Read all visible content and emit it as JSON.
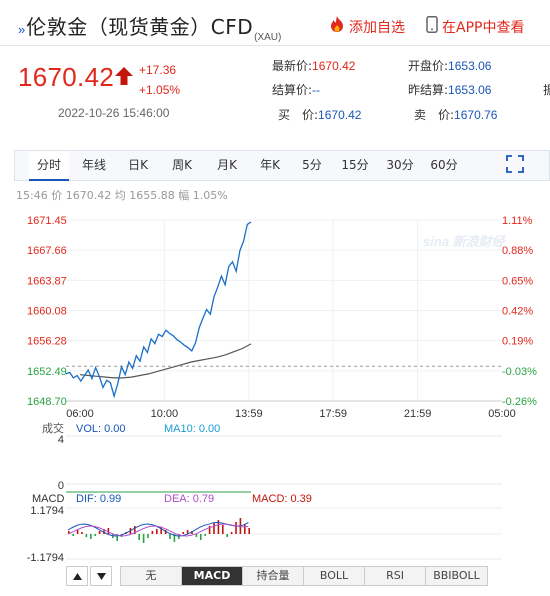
{
  "header": {
    "title_mark": "»",
    "title": "伦敦金（现货黄金）CFD",
    "code": "(XAU)",
    "watch_label": "添加自选",
    "app_label": "在APP中查看"
  },
  "quote": {
    "price": "1670.42",
    "change": "+17.36",
    "change_pct": "+1.05%",
    "time": "2022-10-26 15:46:00",
    "fields": [
      {
        "label": "最新价:",
        "value": "1670.42",
        "color": "red"
      },
      {
        "label": "开盘价:",
        "value": "1653.06",
        "color": "blue"
      },
      {
        "label": "结算价:",
        "value": "--",
        "color": "blue"
      },
      {
        "label": "昨结算:",
        "value": "1653.06",
        "color": "blue"
      },
      {
        "label": "买　价:",
        "value": "1670.42",
        "color": "blue"
      },
      {
        "label": "卖　价:",
        "value": "1670.76",
        "color": "blue"
      }
    ],
    "cutoff_glyph": "振"
  },
  "tabs": [
    "分时",
    "年线",
    "日K",
    "周K",
    "月K",
    "年K",
    "5分",
    "15分",
    "30分",
    "60分"
  ],
  "active_tab": "分时",
  "cursor_info": {
    "time": "15:46",
    "price_label": "价",
    "price": "1670.42",
    "avg_label": "均",
    "avg": "1655.88",
    "amp_label": "幅",
    "amp": "1.05%"
  },
  "watermark": "sina 新浪财经",
  "chart_data": {
    "type": "line",
    "y_ticks": [
      "1671.45",
      "1667.66",
      "1663.87",
      "1660.08",
      "1656.28",
      "1652.49",
      "1648.70"
    ],
    "pct_ticks": [
      "1.11%",
      "0.88%",
      "0.65%",
      "0.42%",
      "0.19%",
      "-0.03%",
      "-0.26%"
    ],
    "ylim": [
      1648.7,
      1671.45
    ],
    "prev_settle": 1653.06,
    "x_ticks": [
      "06:00",
      "10:00",
      "13:59",
      "17:59",
      "21:59",
      "05:00"
    ],
    "series": [
      {
        "name": "price",
        "color": "#1a6fc9"
      },
      {
        "name": "avg",
        "color": "#555555"
      }
    ],
    "price_y": [
      1652.1,
      1652.3,
      1651.6,
      1651.9,
      1651.2,
      1651.9,
      1652.6,
      1651.5,
      1652.9,
      1651.8,
      1650.4,
      1651.3,
      1651.0,
      1649.3,
      1650.9,
      1653.0,
      1652.0,
      1653.6,
      1652.8,
      1654.4,
      1653.7,
      1655.5,
      1654.8,
      1656.5,
      1655.9,
      1657.1,
      1656.8,
      1657.6,
      1657.2,
      1656.9,
      1656.4,
      1656.1,
      1655.7,
      1655.4,
      1655.0,
      1656.0,
      1657.9,
      1659.1,
      1660.2,
      1659.6,
      1661.8,
      1663.0,
      1664.4,
      1663.3,
      1665.6,
      1666.2,
      1665.0,
      1667.6,
      1668.8,
      1670.9,
      1671.2
    ],
    "avg_y": [
      1652.0,
      1651.9,
      1651.8,
      1651.7,
      1651.6,
      1651.6,
      1651.7,
      1651.9,
      1652.1,
      1652.4,
      1652.7,
      1653.0,
      1653.3,
      1653.6,
      1653.8,
      1654.0,
      1654.2,
      1654.5,
      1654.9,
      1655.3,
      1655.88
    ],
    "indicators": {
      "volume": {
        "label": "成交",
        "vol_label": "VOL: 0.00",
        "ma10_label": "MA10: 0.00",
        "y_ticks": [
          "4",
          "0"
        ]
      },
      "macd": {
        "label": "MACD",
        "dif_label": "DIF: 0.99",
        "dea_label": "DEA: 0.79",
        "macd_label": "MACD: 0.39",
        "y_ticks": [
          "1.1794",
          "-1.1794"
        ]
      }
    }
  },
  "bottom": {
    "up_icon": "triangle-up",
    "down_icon": "triangle-down",
    "indicator_tabs": [
      "无",
      "MACD",
      "持合量",
      "BOLL",
      "RSI",
      "BBIBOLL"
    ],
    "active_indicator": "MACD"
  },
  "colors": {
    "red": "#e0281c",
    "blue": "#1a56b9",
    "green": "#2ba244",
    "line": "#1a6fc9"
  }
}
